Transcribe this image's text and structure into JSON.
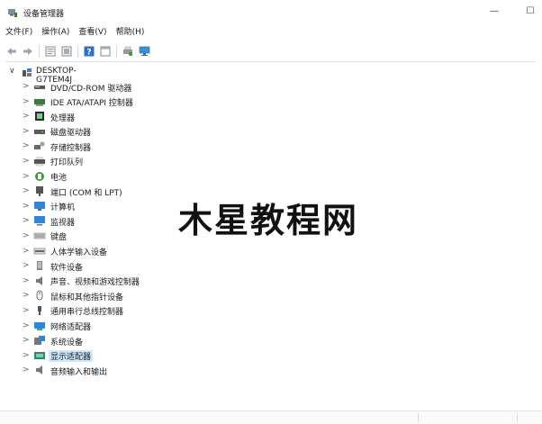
{
  "window": {
    "title": "设备管理器",
    "minimize_glyph": "—",
    "maximize_glyph": "☐"
  },
  "menubar": {
    "items": [
      "文件(F)",
      "操作(A)",
      "查看(V)",
      "帮助(H)"
    ]
  },
  "toolbar": {
    "icons": [
      "back-arrow-icon",
      "forward-arrow-icon",
      "properties-icon",
      "list-view-icon",
      "help-icon",
      "panel-view-icon",
      "print-icon",
      "monitor-icon"
    ]
  },
  "tree": {
    "root": {
      "label": "DESKTOP-G7TEM4J",
      "chevron": "∨"
    },
    "chevron": ">",
    "items": [
      {
        "label": "DVD/CD-ROM 驱动器",
        "icon": "dvd-drive-icon",
        "color": "#5a5a5a"
      },
      {
        "label": "IDE ATA/ATAPI 控制器",
        "icon": "ide-controller-icon",
        "color": "#3a7d3a"
      },
      {
        "label": "处理器",
        "icon": "cpu-icon",
        "color": "#2e2e2e"
      },
      {
        "label": "磁盘驱动器",
        "icon": "disk-drive-icon",
        "color": "#5a5a5a"
      },
      {
        "label": "存储控制器",
        "icon": "storage-controller-icon",
        "color": "#6a6a6a"
      },
      {
        "label": "打印队列",
        "icon": "printer-icon",
        "color": "#555555"
      },
      {
        "label": "电池",
        "icon": "battery-icon",
        "color": "#3a9a3a"
      },
      {
        "label": "端口 (COM 和 LPT)",
        "icon": "port-icon",
        "color": "#555555"
      },
      {
        "label": "计算机",
        "icon": "computer-icon",
        "color": "#2f86d6"
      },
      {
        "label": "监视器",
        "icon": "monitor-icon",
        "color": "#2f86d6"
      },
      {
        "label": "键盘",
        "icon": "keyboard-icon",
        "color": "#777777"
      },
      {
        "label": "人体学输入设备",
        "icon": "hid-icon",
        "color": "#666666"
      },
      {
        "label": "软件设备",
        "icon": "software-device-icon",
        "color": "#888888"
      },
      {
        "label": "声音、视频和游戏控制器",
        "icon": "speaker-icon",
        "color": "#777777"
      },
      {
        "label": "鼠标和其他指针设备",
        "icon": "mouse-icon",
        "color": "#555555"
      },
      {
        "label": "通用串行总线控制器",
        "icon": "usb-icon",
        "color": "#555555"
      },
      {
        "label": "网络适配器",
        "icon": "network-adapter-icon",
        "color": "#2f86d6"
      },
      {
        "label": "系统设备",
        "icon": "system-device-icon",
        "color": "#2f86d6"
      },
      {
        "label": "显示适配器",
        "icon": "display-adapter-icon",
        "color": "#2a8a5a",
        "selected": true
      },
      {
        "label": "音频输入和输出",
        "icon": "audio-io-icon",
        "color": "#777777"
      }
    ]
  },
  "watermark": {
    "text": "木星教程网"
  }
}
